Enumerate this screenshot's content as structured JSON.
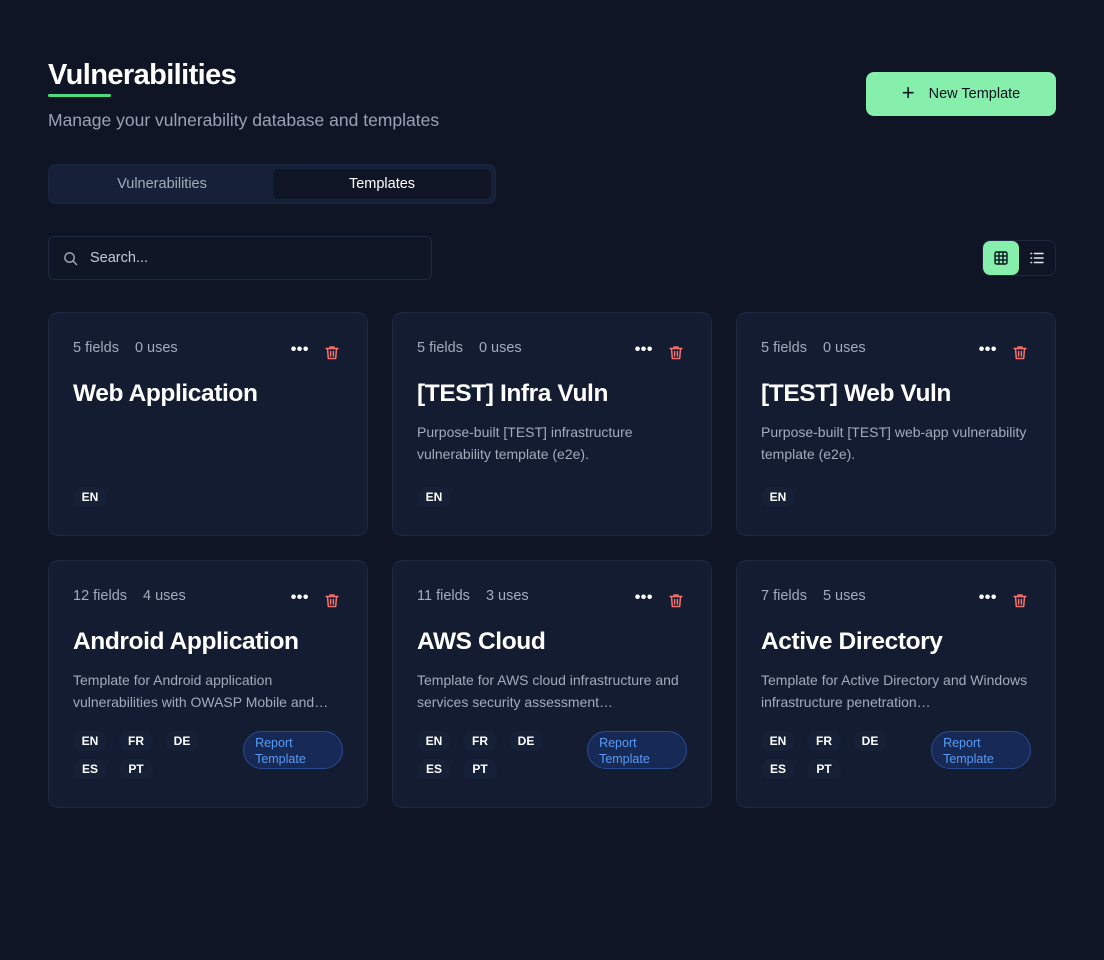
{
  "header": {
    "title": "Vulnerabilities",
    "subtitle": "Manage your vulnerability database and templates",
    "new_button_label": "New Template"
  },
  "tabs": [
    {
      "label": "Vulnerabilities",
      "active": false
    },
    {
      "label": "Templates",
      "active": true
    }
  ],
  "search": {
    "placeholder": "Search...",
    "value": ""
  },
  "view_toggle": {
    "active": "grid-view",
    "options": [
      "grid-view",
      "list-view"
    ]
  },
  "colors": {
    "accent": "#86efac",
    "underline": "#4ade80",
    "danger": "#f87171",
    "badge_text": "#5b9bf5",
    "background": "#0f1525",
    "card_bg": "#131c30"
  },
  "cards": [
    {
      "fields": "5 fields",
      "uses": "0 uses",
      "title": "Web Application",
      "description": "",
      "languages": [
        "EN"
      ],
      "badge": ""
    },
    {
      "fields": "5 fields",
      "uses": "0 uses",
      "title": "[TEST] Infra Vuln",
      "description": "Purpose-built [TEST] infrastructure vulnerability template (e2e).",
      "languages": [
        "EN"
      ],
      "badge": ""
    },
    {
      "fields": "5 fields",
      "uses": "0 uses",
      "title": "[TEST] Web Vuln",
      "description": "Purpose-built [TEST] web-app vulnerability template (e2e).",
      "languages": [
        "EN"
      ],
      "badge": ""
    },
    {
      "fields": "12 fields",
      "uses": "4 uses",
      "title": "Android Application",
      "description": "Template for Android application vulnerabilities with OWASP Mobile and…",
      "languages": [
        "EN",
        "FR",
        "DE",
        "ES",
        "PT"
      ],
      "badge": "Report Template"
    },
    {
      "fields": "11 fields",
      "uses": "3 uses",
      "title": "AWS Cloud",
      "description": "Template for AWS cloud infrastructure and services security assessment…",
      "languages": [
        "EN",
        "FR",
        "DE",
        "ES",
        "PT"
      ],
      "badge": "Report Template"
    },
    {
      "fields": "7 fields",
      "uses": "5 uses",
      "title": "Active Directory",
      "description": "Template for Active Directory and Windows infrastructure penetration…",
      "languages": [
        "EN",
        "FR",
        "DE",
        "ES",
        "PT"
      ],
      "badge": "Report Template"
    }
  ]
}
